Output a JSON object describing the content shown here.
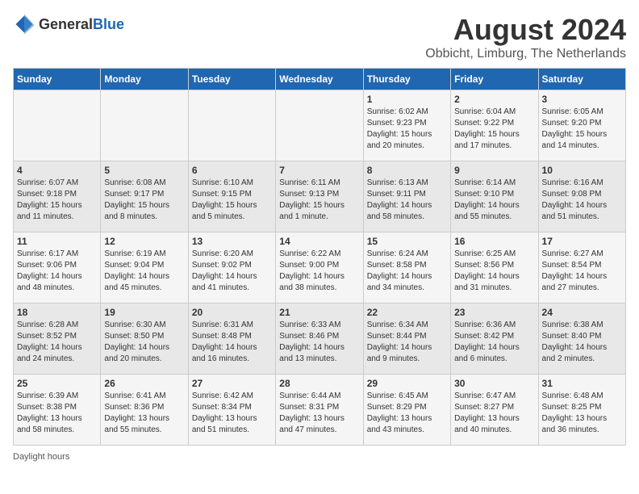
{
  "header": {
    "logo_general": "General",
    "logo_blue": "Blue",
    "main_title": "August 2024",
    "subtitle": "Obbicht, Limburg, The Netherlands"
  },
  "footer": {
    "note": "Daylight hours"
  },
  "days_of_week": [
    "Sunday",
    "Monday",
    "Tuesday",
    "Wednesday",
    "Thursday",
    "Friday",
    "Saturday"
  ],
  "weeks": [
    [
      {
        "day": "",
        "info": ""
      },
      {
        "day": "",
        "info": ""
      },
      {
        "day": "",
        "info": ""
      },
      {
        "day": "",
        "info": ""
      },
      {
        "day": "1",
        "info": "Sunrise: 6:02 AM\nSunset: 9:23 PM\nDaylight: 15 hours\nand 20 minutes."
      },
      {
        "day": "2",
        "info": "Sunrise: 6:04 AM\nSunset: 9:22 PM\nDaylight: 15 hours\nand 17 minutes."
      },
      {
        "day": "3",
        "info": "Sunrise: 6:05 AM\nSunset: 9:20 PM\nDaylight: 15 hours\nand 14 minutes."
      }
    ],
    [
      {
        "day": "4",
        "info": "Sunrise: 6:07 AM\nSunset: 9:18 PM\nDaylight: 15 hours\nand 11 minutes."
      },
      {
        "day": "5",
        "info": "Sunrise: 6:08 AM\nSunset: 9:17 PM\nDaylight: 15 hours\nand 8 minutes."
      },
      {
        "day": "6",
        "info": "Sunrise: 6:10 AM\nSunset: 9:15 PM\nDaylight: 15 hours\nand 5 minutes."
      },
      {
        "day": "7",
        "info": "Sunrise: 6:11 AM\nSunset: 9:13 PM\nDaylight: 15 hours\nand 1 minute."
      },
      {
        "day": "8",
        "info": "Sunrise: 6:13 AM\nSunset: 9:11 PM\nDaylight: 14 hours\nand 58 minutes."
      },
      {
        "day": "9",
        "info": "Sunrise: 6:14 AM\nSunset: 9:10 PM\nDaylight: 14 hours\nand 55 minutes."
      },
      {
        "day": "10",
        "info": "Sunrise: 6:16 AM\nSunset: 9:08 PM\nDaylight: 14 hours\nand 51 minutes."
      }
    ],
    [
      {
        "day": "11",
        "info": "Sunrise: 6:17 AM\nSunset: 9:06 PM\nDaylight: 14 hours\nand 48 minutes."
      },
      {
        "day": "12",
        "info": "Sunrise: 6:19 AM\nSunset: 9:04 PM\nDaylight: 14 hours\nand 45 minutes."
      },
      {
        "day": "13",
        "info": "Sunrise: 6:20 AM\nSunset: 9:02 PM\nDaylight: 14 hours\nand 41 minutes."
      },
      {
        "day": "14",
        "info": "Sunrise: 6:22 AM\nSunset: 9:00 PM\nDaylight: 14 hours\nand 38 minutes."
      },
      {
        "day": "15",
        "info": "Sunrise: 6:24 AM\nSunset: 8:58 PM\nDaylight: 14 hours\nand 34 minutes."
      },
      {
        "day": "16",
        "info": "Sunrise: 6:25 AM\nSunset: 8:56 PM\nDaylight: 14 hours\nand 31 minutes."
      },
      {
        "day": "17",
        "info": "Sunrise: 6:27 AM\nSunset: 8:54 PM\nDaylight: 14 hours\nand 27 minutes."
      }
    ],
    [
      {
        "day": "18",
        "info": "Sunrise: 6:28 AM\nSunset: 8:52 PM\nDaylight: 14 hours\nand 24 minutes."
      },
      {
        "day": "19",
        "info": "Sunrise: 6:30 AM\nSunset: 8:50 PM\nDaylight: 14 hours\nand 20 minutes."
      },
      {
        "day": "20",
        "info": "Sunrise: 6:31 AM\nSunset: 8:48 PM\nDaylight: 14 hours\nand 16 minutes."
      },
      {
        "day": "21",
        "info": "Sunrise: 6:33 AM\nSunset: 8:46 PM\nDaylight: 14 hours\nand 13 minutes."
      },
      {
        "day": "22",
        "info": "Sunrise: 6:34 AM\nSunset: 8:44 PM\nDaylight: 14 hours\nand 9 minutes."
      },
      {
        "day": "23",
        "info": "Sunrise: 6:36 AM\nSunset: 8:42 PM\nDaylight: 14 hours\nand 6 minutes."
      },
      {
        "day": "24",
        "info": "Sunrise: 6:38 AM\nSunset: 8:40 PM\nDaylight: 14 hours\nand 2 minutes."
      }
    ],
    [
      {
        "day": "25",
        "info": "Sunrise: 6:39 AM\nSunset: 8:38 PM\nDaylight: 13 hours\nand 58 minutes."
      },
      {
        "day": "26",
        "info": "Sunrise: 6:41 AM\nSunset: 8:36 PM\nDaylight: 13 hours\nand 55 minutes."
      },
      {
        "day": "27",
        "info": "Sunrise: 6:42 AM\nSunset: 8:34 PM\nDaylight: 13 hours\nand 51 minutes."
      },
      {
        "day": "28",
        "info": "Sunrise: 6:44 AM\nSunset: 8:31 PM\nDaylight: 13 hours\nand 47 minutes."
      },
      {
        "day": "29",
        "info": "Sunrise: 6:45 AM\nSunset: 8:29 PM\nDaylight: 13 hours\nand 43 minutes."
      },
      {
        "day": "30",
        "info": "Sunrise: 6:47 AM\nSunset: 8:27 PM\nDaylight: 13 hours\nand 40 minutes."
      },
      {
        "day": "31",
        "info": "Sunrise: 6:48 AM\nSunset: 8:25 PM\nDaylight: 13 hours\nand 36 minutes."
      }
    ]
  ]
}
